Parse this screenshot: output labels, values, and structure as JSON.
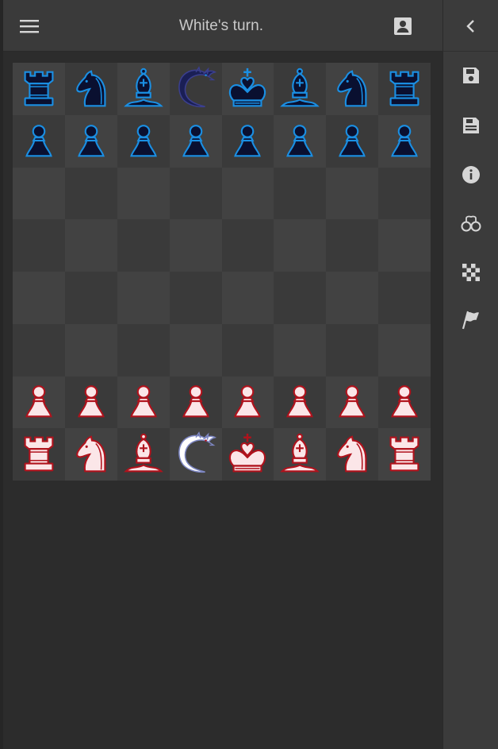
{
  "header": {
    "status": "White's turn.",
    "menu_icon": "hamburger-menu-icon",
    "profile_icon": "account-box-icon"
  },
  "board": {
    "files": 8,
    "ranks": 8,
    "square_colors": {
      "light": "#424242",
      "dark": "#3a3a3a"
    },
    "position": [
      [
        "black-rook",
        "black-knight",
        "black-bishop",
        "black-dragon",
        "black-king",
        "black-bishop",
        "black-knight",
        "black-rook"
      ],
      [
        "black-pawn",
        "black-pawn",
        "black-pawn",
        "black-pawn",
        "black-pawn",
        "black-pawn",
        "black-pawn",
        "black-pawn"
      ],
      [
        "",
        "",
        "",
        "",
        "",
        "",
        "",
        ""
      ],
      [
        "",
        "",
        "",
        "",
        "",
        "",
        "",
        ""
      ],
      [
        "",
        "",
        "",
        "",
        "",
        "",
        "",
        ""
      ],
      [
        "",
        "",
        "",
        "",
        "",
        "",
        "",
        ""
      ],
      [
        "white-pawn",
        "white-pawn",
        "white-pawn",
        "white-pawn",
        "white-pawn",
        "white-pawn",
        "white-pawn",
        "white-pawn"
      ],
      [
        "white-rook",
        "white-knight",
        "white-bishop",
        "white-dragon",
        "white-king",
        "white-bishop",
        "white-knight",
        "white-rook"
      ]
    ],
    "piece_colors": {
      "black": {
        "fill": "#0a1030",
        "accent": "#1a8fe3"
      },
      "white": {
        "fill": "#fbe6e8",
        "accent": "#b0121c"
      }
    }
  },
  "sidebar": {
    "collapse_icon": "chevron-left-icon",
    "buttons": [
      {
        "icon": "save-icon"
      },
      {
        "icon": "load-game-icon"
      },
      {
        "icon": "info-icon"
      },
      {
        "icon": "handcuffs-icon"
      },
      {
        "icon": "checkerboard-icon"
      },
      {
        "icon": "flag-icon"
      }
    ]
  },
  "colors": {
    "background": "#2c2c2c",
    "topbar": "#3a3a3a",
    "sidebar": "#3b3b3b",
    "text": "#c9c9c9",
    "icon": "#d6d6d6"
  }
}
